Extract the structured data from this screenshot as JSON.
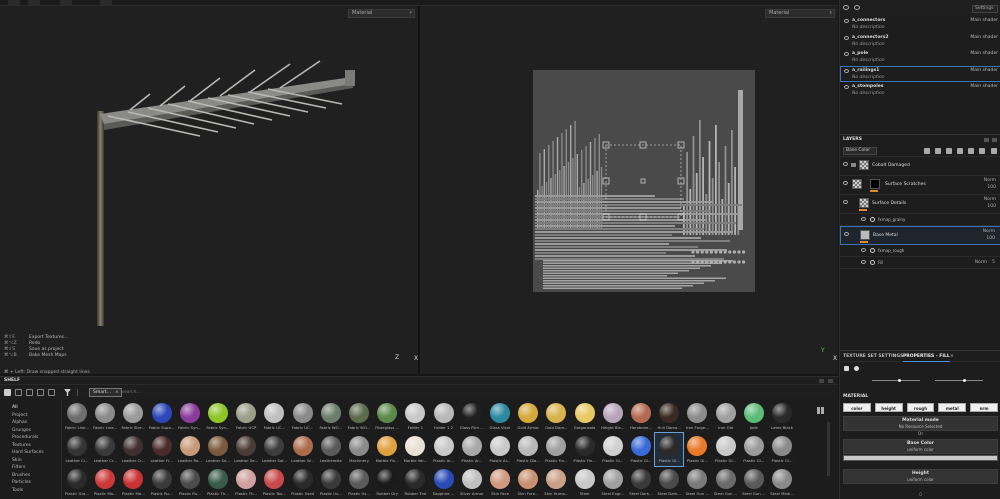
{
  "viewport3d": {
    "mode": "Material",
    "axis_z": "Z",
    "axis_x": "X"
  },
  "viewport2d": {
    "mode": "Material",
    "axis_y": "Y",
    "axis_x": "X"
  },
  "shortcuts": [
    {
      "key": "⌘⇧E",
      "label": "Export Textures..."
    },
    {
      "key": "⌘⌥Z",
      "label": "Redo"
    },
    {
      "key": "⌘⇧S",
      "label": "Save as project"
    },
    {
      "key": "⌘⌥B",
      "label": "Bake Mesh Maps"
    }
  ],
  "hint": "⌘ + Left: Draw snapped straight lines",
  "shelf": {
    "title": "SHELF",
    "filter_chip": "Smart...",
    "search_placeholder": "Search...",
    "categories": [
      "All",
      "Project",
      "Alphas",
      "Grunges",
      "Procedurals",
      "Textures",
      "Hard Surfaces",
      "Skin",
      "Filters",
      "Brushes",
      "Particles",
      "Tools"
    ],
    "materials_row1": [
      "Fabric Line...",
      "Fabric Line...",
      "Fabric Stre...",
      "Fabric Supe...",
      "Fabric Syn...",
      "Fabric Syn...",
      "Fabric UCP",
      "Fabric UC...",
      "Fabric UC...",
      "Fabric WO...",
      "Fabric WO...",
      "Fiberglass ...",
      "Folder 1",
      "Folder 1 2",
      "Glass Film ...",
      "Glass Visor",
      "Gold Armor",
      "Gold Dam...",
      "Gorgonzola",
      "Height Ble...",
      "Hornbone...",
      "Hull Dama...",
      "Iron Forge...",
      "Iron Old",
      "Jade",
      "Latex Black"
    ],
    "materials_row2": [
      "Leather Cl...",
      "Leather Cr...",
      "Leather Cr...",
      "Leather Fi...",
      "Leather Ro...",
      "Leather Se...",
      "Leather Se...",
      "Leather Sof...",
      "Leather W...",
      "Leatherette",
      "Machinery",
      "Marble Fin...",
      "Marble Ver...",
      "Plastic Ar...",
      "Plastic Ar...",
      "Plastic Ar...",
      "Plastic Dia...",
      "Plastic Fin...",
      "Plastic Fin...",
      "Plastic Gl...",
      "Plastic Gl...",
      "Plastic Gl...",
      "Plastic Gl...",
      "Plastic Gl...",
      "Plastic Gl...",
      "Plastic Gl..."
    ],
    "materials_row3": [
      "Plastic Gra...",
      "Plastic Ma...",
      "Plastic Ma...",
      "Plastic Ru...",
      "Plastic Ru...",
      "Plastic Th...",
      "Plastic Th...",
      "Plastic Too...",
      "Plastic Used",
      "Plastic Us...",
      "Plastic Us...",
      "Rubber Dry",
      "Rubber Tire",
      "Sapphire ...",
      "Silver Armor",
      "Skin Face",
      "Skin Fore...",
      "Skin Huma...",
      "Steel",
      "Steel Engr...",
      "Steel Dark...",
      "Steel Dark...",
      "Steel Gun ...",
      "Steel Gun ...",
      "Steel Gun ...",
      "Steel Medi..."
    ],
    "colors_row1": [
      "#6d6d6d",
      "#8a8a8a",
      "#9a9a9a",
      "#2b47b8",
      "#8a3c9a",
      "#8ec62a",
      "#9a9e8a",
      "#c0c0c0",
      "#8a8a8a",
      "#6e7e6e",
      "#5c6b4c",
      "#5d8a4a",
      "#c8c8c8",
      "#b8b8b8",
      "#1f1f1f",
      "#2c8aa0",
      "#d4a93a",
      "#d8b24a",
      "#e8c862",
      "#b8a4ba",
      "#b46a52",
      "#3a2a22",
      "#8c8c8c",
      "#a0a0a0",
      "#5cbc78",
      "#2a2a2a"
    ],
    "colors_row2": [
      "#343434",
      "#3a3a3a",
      "#403030",
      "#4a2a2a",
      "#c69a78",
      "#7a5a3a",
      "#4a3a34",
      "#3c3c3c",
      "#ac6c4c",
      "#5a5a5a",
      "#8a8a8a",
      "#e0a040",
      "#e8e0d4",
      "#c8c8c8",
      "#a8a8a8",
      "#c8c8c8",
      "#b8b8b8",
      "#a0a0a0",
      "#2a2a2a",
      "#d0d0d0",
      "#3a6ad8",
      "#2a2a2a",
      "#e87a2a",
      "#c8c8c8",
      "#9a9a9a",
      "#8a8a8a"
    ],
    "colors_row3": [
      "#2a2a2a",
      "#cc3838",
      "#c83434",
      "#3a3a3a",
      "#4a4a4a",
      "#3a5a4a",
      "#d0a0a0",
      "#c84a4a",
      "#2a2a2a",
      "#3a3a3a",
      "#5a5a5a",
      "#1a1a1a",
      "#2a2a2a",
      "#2a4ab8",
      "#c0c0c0",
      "#d09a80",
      "#c89070",
      "#c8a088",
      "#c8c8c8",
      "#a0a0a0",
      "#3a3a3a",
      "#4a4a4a",
      "#7a7a7a",
      "#6a6a6a",
      "#5a5a5a",
      "#8a8a8a"
    ]
  },
  "texture_sets": {
    "settings_label": "Settings",
    "items": [
      {
        "name": "a_connectors",
        "desc": "No description",
        "shader": "Main shader"
      },
      {
        "name": "a_connectors2",
        "desc": "No description",
        "shader": "Main shader"
      },
      {
        "name": "a_pole",
        "desc": "No description",
        "shader": "Main shader"
      },
      {
        "name": "a_railings1",
        "desc": "No description",
        "shader": "Main shader"
      },
      {
        "name": "a_stompoles",
        "desc": "No description",
        "shader": "Main shader"
      }
    ]
  },
  "layers": {
    "title": "LAYERS",
    "channel": "Base Color",
    "rows": [
      {
        "name": "Cobalt Damaged",
        "blend": "",
        "opacity": ""
      },
      {
        "name": "Surface Scratches",
        "blend": "Norm",
        "opacity": "100"
      },
      {
        "name": "Surface Details",
        "blend": "Norm",
        "opacity": "100"
      },
      {
        "name": "fxmap_grainy",
        "blend": "",
        "opacity": ""
      },
      {
        "name": "Base Metal",
        "blend": "Norm",
        "opacity": "100"
      },
      {
        "name": "fxmap_rough",
        "blend": "",
        "opacity": ""
      },
      {
        "name": "Fill",
        "blend": "Norm",
        "opacity": "5"
      }
    ]
  },
  "properties": {
    "tab1": "TEXTURE SET SETTINGS",
    "tab2": "PROPERTIES - FILL",
    "section": "MATERIAL",
    "channels": [
      "color",
      "height",
      "rough",
      "metal",
      "nrm"
    ],
    "material_mode_title": "Material mode",
    "material_mode_value": "No Resource Selected",
    "or_label": "Or",
    "base_color_title": "Base Color",
    "base_color_value": "uniform color",
    "height_title": "Height",
    "height_value": "uniform color",
    "height_number": "0"
  }
}
